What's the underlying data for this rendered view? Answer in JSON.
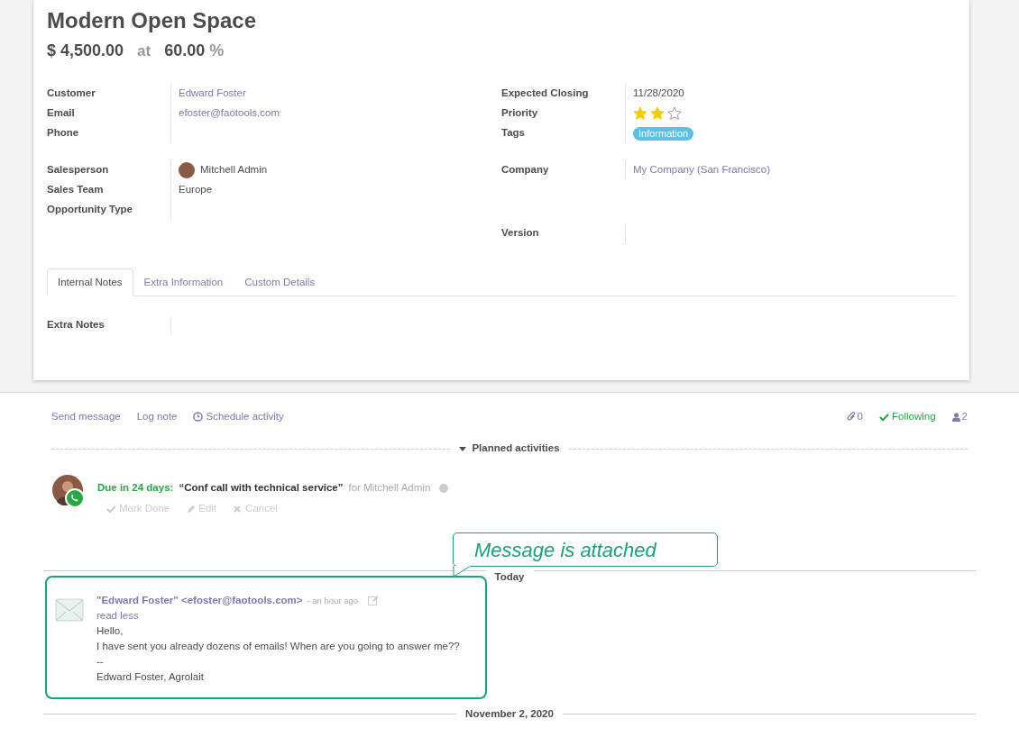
{
  "record": {
    "title": "Modern Open Space",
    "amount": "$ 4,500.00",
    "at": "at",
    "probability": "60.00",
    "percent": "%"
  },
  "left_groups": [
    [
      {
        "label": "Customer",
        "value": "Edward Foster",
        "kind": "link"
      },
      {
        "label": "Email",
        "value": "efoster@faotools.com",
        "kind": "link"
      },
      {
        "label": "Phone"
      }
    ],
    [
      {
        "label": "Salesperson",
        "value": "Mitchell Admin",
        "kind": "user"
      },
      {
        "label": "Sales Team",
        "value": "Europe",
        "kind": "text"
      },
      {
        "label": "Opportunity Type"
      }
    ]
  ],
  "right_groups": [
    [
      {
        "label": "Expected Closing",
        "value": "11/28/2020",
        "kind": "text"
      },
      {
        "label": "Priority",
        "kind": "stars",
        "stars": 2
      },
      {
        "label": "Tags",
        "kind": "tag",
        "value": "Information",
        "color": "#5bc0e6"
      }
    ],
    [
      {
        "label": "Company",
        "value": "My Company (San Francisco)",
        "kind": "link"
      }
    ],
    [
      {
        "label": "Version"
      }
    ]
  ],
  "tabs": [
    {
      "label": "Internal Notes",
      "selected": true
    },
    {
      "label": "Extra Information",
      "selected": false
    },
    {
      "label": "Custom Details",
      "selected": false
    }
  ],
  "notes_field": {
    "label": "Extra Notes"
  },
  "chatter": {
    "actions": [
      "Send message",
      "Log note",
      "Schedule activity"
    ],
    "attachments": "0",
    "following": "Following",
    "followers": "2"
  },
  "planned": {
    "title": "Planned activities",
    "due": "Due in 24 days:",
    "summary": "“Conf call with technical service”",
    "assignee": "for Mitchell Admin",
    "buttons": [
      "Mark Done",
      "Edit",
      "Cancel"
    ]
  },
  "separator": "Today",
  "callout": "Message is attached",
  "message": {
    "author": "\"Edward Foster\" <efoster@faotools.com>",
    "time": "- an hour ago",
    "toggle": "read less",
    "lines": [
      "Hello,",
      "I have sent you already dozens of emails! When are you going to answer me??",
      "--",
      "Edward Foster, Agrolait"
    ]
  },
  "separator_2": "November 2, 2020"
}
